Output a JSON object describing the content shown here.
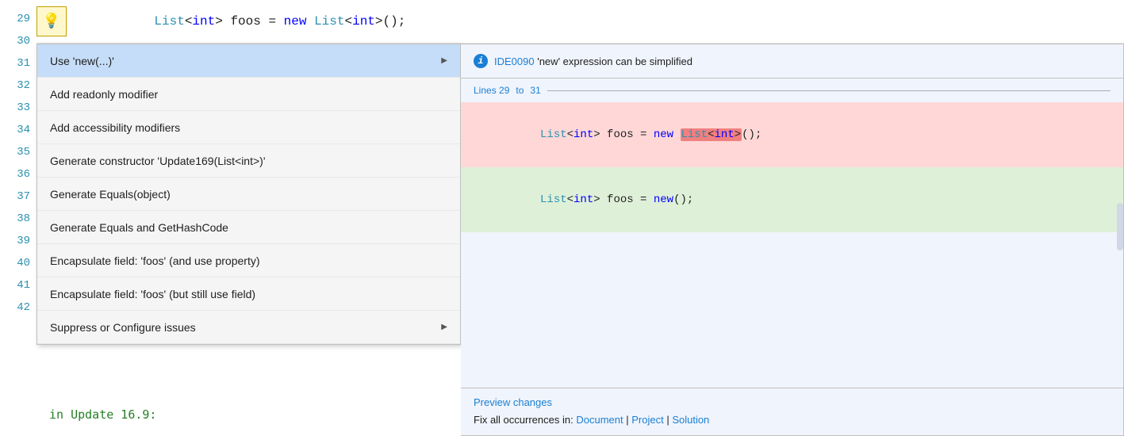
{
  "editor": {
    "line_numbers": [
      "29",
      "30",
      "31",
      "32",
      "33",
      "34",
      "35",
      "36",
      "37",
      "38",
      "39",
      "40",
      "41",
      "42"
    ],
    "top_code": "    List<int> foos = new List<int>();",
    "bottom_code": "in Update 16.9:"
  },
  "bulb": {
    "icon": "💡",
    "arrow": "▾"
  },
  "menu": {
    "items": [
      {
        "label": "Use 'new(...)'",
        "has_arrow": true,
        "selected": true
      },
      {
        "label": "Add readonly modifier",
        "has_arrow": false,
        "selected": false
      },
      {
        "label": "Add accessibility modifiers",
        "has_arrow": false,
        "selected": false
      },
      {
        "label": "Generate constructor 'Update169(List<int>)'",
        "has_arrow": false,
        "selected": false
      },
      {
        "label": "Generate Equals(object)",
        "has_arrow": false,
        "selected": false
      },
      {
        "label": "Generate Equals and GetHashCode",
        "has_arrow": false,
        "selected": false
      },
      {
        "label": "Encapsulate field: 'foos' (and use property)",
        "has_arrow": false,
        "selected": false
      },
      {
        "label": "Encapsulate field: 'foos' (but still use field)",
        "has_arrow": false,
        "selected": false
      },
      {
        "label": "Suppress or Configure issues",
        "has_arrow": true,
        "selected": false
      }
    ]
  },
  "preview": {
    "info_icon": "i",
    "title_code_id": "IDE0090",
    "title_message": "'new' expression can be simplified",
    "lines_label": "Lines 29 to 31",
    "removed_line": "    List<int> foos = new List<int>();",
    "removed_highlight": "List<int>",
    "added_line": "    List<int> foos = new();",
    "preview_changes_label": "Preview changes",
    "fix_all_prefix": "Fix all occurrences in:",
    "fix_document": "Document",
    "fix_project": "Project",
    "fix_solution": "Solution",
    "separator1": "|",
    "separator2": "|"
  }
}
